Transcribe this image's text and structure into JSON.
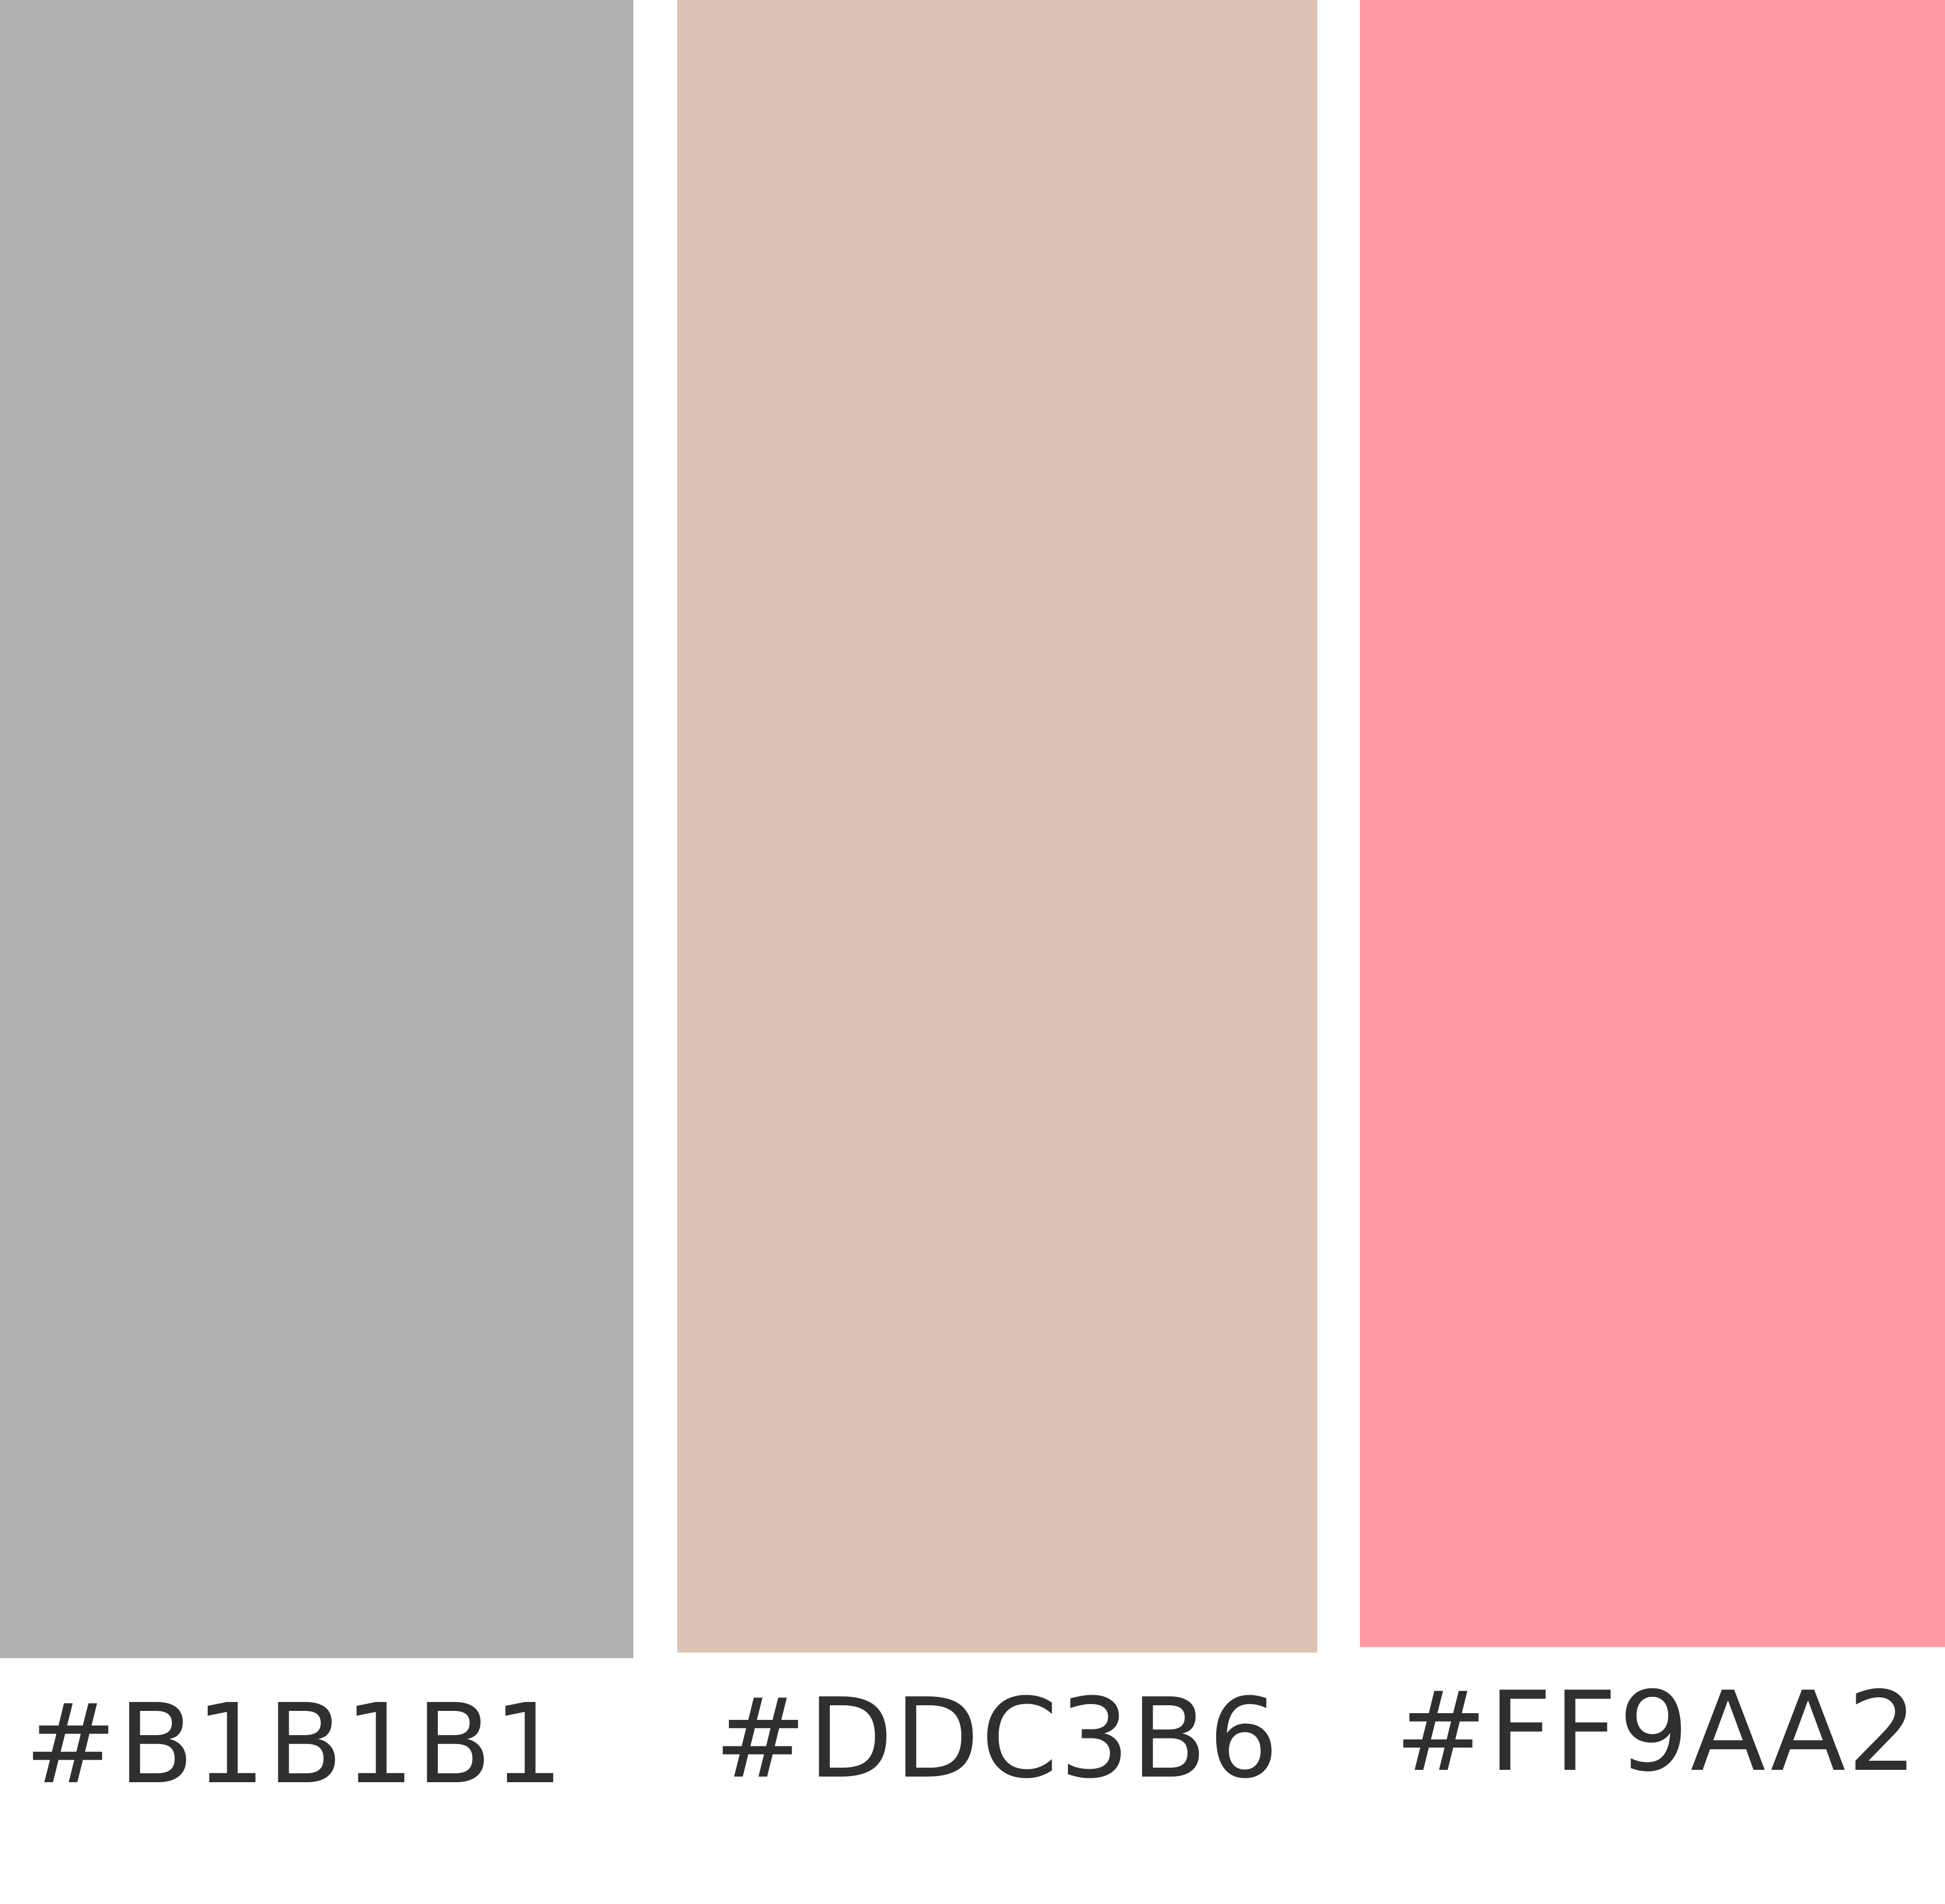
{
  "palette": {
    "swatches": [
      {
        "color": "#B1B1B1",
        "label": "#B1B1B1"
      },
      {
        "color": "#DDC3B6",
        "label": "#DDC3B6"
      },
      {
        "color": "#FF9AA2",
        "label": "#FF9AA2"
      }
    ]
  }
}
